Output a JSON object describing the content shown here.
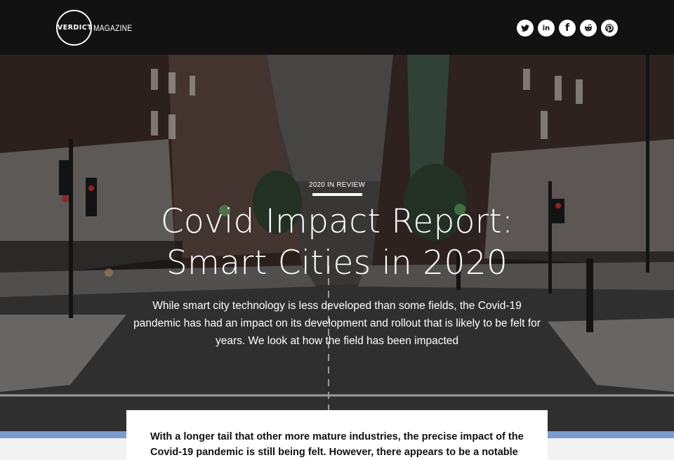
{
  "brand": {
    "logo_word": "VERDICT",
    "logo_suffix": "MAGAZINE"
  },
  "social": [
    {
      "name": "twitter-icon"
    },
    {
      "name": "linkedin-icon",
      "label": "in"
    },
    {
      "name": "facebook-icon",
      "label": "f"
    },
    {
      "name": "reddit-icon"
    },
    {
      "name": "pinterest-icon"
    }
  ],
  "hero": {
    "kicker": "2020 IN REVIEW",
    "title_line1": "Covid Impact Report:",
    "title_line2": "Smart Cities in 2020",
    "subtitle": "While smart city technology is less developed than some fields, the Covid-19 pandemic has had an impact on its development and rollout that is likely to be felt for years. We look at how the field has been impacted"
  },
  "article": {
    "lead": "With a longer tail that other more mature industries, the precise impact of the Covid-19 pandemic is still being felt. However, there appears to be a notable"
  },
  "colors": {
    "header_bg": "#121212",
    "accent_band": "#7a9bd0"
  }
}
